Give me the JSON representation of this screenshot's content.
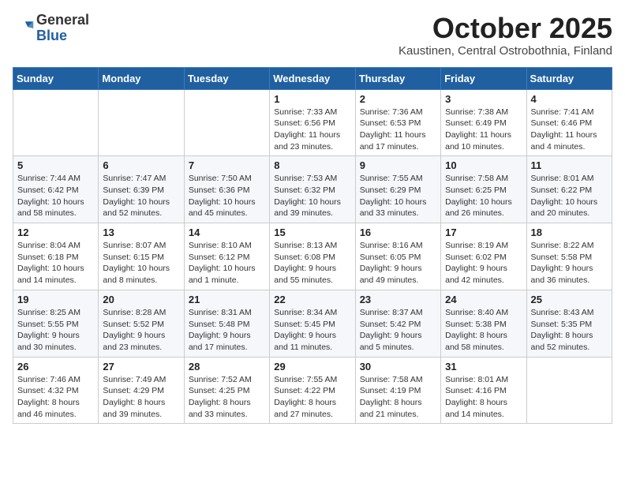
{
  "logo": {
    "general": "General",
    "blue": "Blue"
  },
  "header": {
    "month": "October 2025",
    "location": "Kaustinen, Central Ostrobothnia, Finland"
  },
  "weekdays": [
    "Sunday",
    "Monday",
    "Tuesday",
    "Wednesday",
    "Thursday",
    "Friday",
    "Saturday"
  ],
  "weeks": [
    [
      {
        "day": "",
        "info": ""
      },
      {
        "day": "",
        "info": ""
      },
      {
        "day": "",
        "info": ""
      },
      {
        "day": "1",
        "info": "Sunrise: 7:33 AM\nSunset: 6:56 PM\nDaylight: 11 hours\nand 23 minutes."
      },
      {
        "day": "2",
        "info": "Sunrise: 7:36 AM\nSunset: 6:53 PM\nDaylight: 11 hours\nand 17 minutes."
      },
      {
        "day": "3",
        "info": "Sunrise: 7:38 AM\nSunset: 6:49 PM\nDaylight: 11 hours\nand 10 minutes."
      },
      {
        "day": "4",
        "info": "Sunrise: 7:41 AM\nSunset: 6:46 PM\nDaylight: 11 hours\nand 4 minutes."
      }
    ],
    [
      {
        "day": "5",
        "info": "Sunrise: 7:44 AM\nSunset: 6:42 PM\nDaylight: 10 hours\nand 58 minutes."
      },
      {
        "day": "6",
        "info": "Sunrise: 7:47 AM\nSunset: 6:39 PM\nDaylight: 10 hours\nand 52 minutes."
      },
      {
        "day": "7",
        "info": "Sunrise: 7:50 AM\nSunset: 6:36 PM\nDaylight: 10 hours\nand 45 minutes."
      },
      {
        "day": "8",
        "info": "Sunrise: 7:53 AM\nSunset: 6:32 PM\nDaylight: 10 hours\nand 39 minutes."
      },
      {
        "day": "9",
        "info": "Sunrise: 7:55 AM\nSunset: 6:29 PM\nDaylight: 10 hours\nand 33 minutes."
      },
      {
        "day": "10",
        "info": "Sunrise: 7:58 AM\nSunset: 6:25 PM\nDaylight: 10 hours\nand 26 minutes."
      },
      {
        "day": "11",
        "info": "Sunrise: 8:01 AM\nSunset: 6:22 PM\nDaylight: 10 hours\nand 20 minutes."
      }
    ],
    [
      {
        "day": "12",
        "info": "Sunrise: 8:04 AM\nSunset: 6:18 PM\nDaylight: 10 hours\nand 14 minutes."
      },
      {
        "day": "13",
        "info": "Sunrise: 8:07 AM\nSunset: 6:15 PM\nDaylight: 10 hours\nand 8 minutes."
      },
      {
        "day": "14",
        "info": "Sunrise: 8:10 AM\nSunset: 6:12 PM\nDaylight: 10 hours\nand 1 minute."
      },
      {
        "day": "15",
        "info": "Sunrise: 8:13 AM\nSunset: 6:08 PM\nDaylight: 9 hours\nand 55 minutes."
      },
      {
        "day": "16",
        "info": "Sunrise: 8:16 AM\nSunset: 6:05 PM\nDaylight: 9 hours\nand 49 minutes."
      },
      {
        "day": "17",
        "info": "Sunrise: 8:19 AM\nSunset: 6:02 PM\nDaylight: 9 hours\nand 42 minutes."
      },
      {
        "day": "18",
        "info": "Sunrise: 8:22 AM\nSunset: 5:58 PM\nDaylight: 9 hours\nand 36 minutes."
      }
    ],
    [
      {
        "day": "19",
        "info": "Sunrise: 8:25 AM\nSunset: 5:55 PM\nDaylight: 9 hours\nand 30 minutes."
      },
      {
        "day": "20",
        "info": "Sunrise: 8:28 AM\nSunset: 5:52 PM\nDaylight: 9 hours\nand 23 minutes."
      },
      {
        "day": "21",
        "info": "Sunrise: 8:31 AM\nSunset: 5:48 PM\nDaylight: 9 hours\nand 17 minutes."
      },
      {
        "day": "22",
        "info": "Sunrise: 8:34 AM\nSunset: 5:45 PM\nDaylight: 9 hours\nand 11 minutes."
      },
      {
        "day": "23",
        "info": "Sunrise: 8:37 AM\nSunset: 5:42 PM\nDaylight: 9 hours\nand 5 minutes."
      },
      {
        "day": "24",
        "info": "Sunrise: 8:40 AM\nSunset: 5:38 PM\nDaylight: 8 hours\nand 58 minutes."
      },
      {
        "day": "25",
        "info": "Sunrise: 8:43 AM\nSunset: 5:35 PM\nDaylight: 8 hours\nand 52 minutes."
      }
    ],
    [
      {
        "day": "26",
        "info": "Sunrise: 7:46 AM\nSunset: 4:32 PM\nDaylight: 8 hours\nand 46 minutes."
      },
      {
        "day": "27",
        "info": "Sunrise: 7:49 AM\nSunset: 4:29 PM\nDaylight: 8 hours\nand 39 minutes."
      },
      {
        "day": "28",
        "info": "Sunrise: 7:52 AM\nSunset: 4:25 PM\nDaylight: 8 hours\nand 33 minutes."
      },
      {
        "day": "29",
        "info": "Sunrise: 7:55 AM\nSunset: 4:22 PM\nDaylight: 8 hours\nand 27 minutes."
      },
      {
        "day": "30",
        "info": "Sunrise: 7:58 AM\nSunset: 4:19 PM\nDaylight: 8 hours\nand 21 minutes."
      },
      {
        "day": "31",
        "info": "Sunrise: 8:01 AM\nSunset: 4:16 PM\nDaylight: 8 hours\nand 14 minutes."
      },
      {
        "day": "",
        "info": ""
      }
    ]
  ]
}
